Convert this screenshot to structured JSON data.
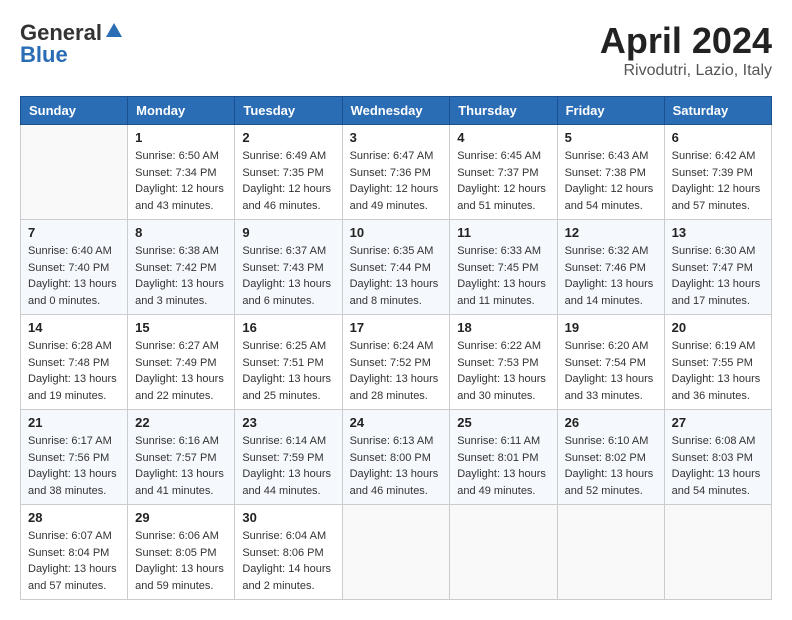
{
  "header": {
    "logo_general": "General",
    "logo_blue": "Blue",
    "title": "April 2024",
    "location": "Rivodutri, Lazio, Italy"
  },
  "calendar": {
    "columns": [
      "Sunday",
      "Monday",
      "Tuesday",
      "Wednesday",
      "Thursday",
      "Friday",
      "Saturday"
    ],
    "weeks": [
      [
        {
          "day": "",
          "info": ""
        },
        {
          "day": "1",
          "info": "Sunrise: 6:50 AM\nSunset: 7:34 PM\nDaylight: 12 hours\nand 43 minutes."
        },
        {
          "day": "2",
          "info": "Sunrise: 6:49 AM\nSunset: 7:35 PM\nDaylight: 12 hours\nand 46 minutes."
        },
        {
          "day": "3",
          "info": "Sunrise: 6:47 AM\nSunset: 7:36 PM\nDaylight: 12 hours\nand 49 minutes."
        },
        {
          "day": "4",
          "info": "Sunrise: 6:45 AM\nSunset: 7:37 PM\nDaylight: 12 hours\nand 51 minutes."
        },
        {
          "day": "5",
          "info": "Sunrise: 6:43 AM\nSunset: 7:38 PM\nDaylight: 12 hours\nand 54 minutes."
        },
        {
          "day": "6",
          "info": "Sunrise: 6:42 AM\nSunset: 7:39 PM\nDaylight: 12 hours\nand 57 minutes."
        }
      ],
      [
        {
          "day": "7",
          "info": "Sunrise: 6:40 AM\nSunset: 7:40 PM\nDaylight: 13 hours\nand 0 minutes."
        },
        {
          "day": "8",
          "info": "Sunrise: 6:38 AM\nSunset: 7:42 PM\nDaylight: 13 hours\nand 3 minutes."
        },
        {
          "day": "9",
          "info": "Sunrise: 6:37 AM\nSunset: 7:43 PM\nDaylight: 13 hours\nand 6 minutes."
        },
        {
          "day": "10",
          "info": "Sunrise: 6:35 AM\nSunset: 7:44 PM\nDaylight: 13 hours\nand 8 minutes."
        },
        {
          "day": "11",
          "info": "Sunrise: 6:33 AM\nSunset: 7:45 PM\nDaylight: 13 hours\nand 11 minutes."
        },
        {
          "day": "12",
          "info": "Sunrise: 6:32 AM\nSunset: 7:46 PM\nDaylight: 13 hours\nand 14 minutes."
        },
        {
          "day": "13",
          "info": "Sunrise: 6:30 AM\nSunset: 7:47 PM\nDaylight: 13 hours\nand 17 minutes."
        }
      ],
      [
        {
          "day": "14",
          "info": "Sunrise: 6:28 AM\nSunset: 7:48 PM\nDaylight: 13 hours\nand 19 minutes."
        },
        {
          "day": "15",
          "info": "Sunrise: 6:27 AM\nSunset: 7:49 PM\nDaylight: 13 hours\nand 22 minutes."
        },
        {
          "day": "16",
          "info": "Sunrise: 6:25 AM\nSunset: 7:51 PM\nDaylight: 13 hours\nand 25 minutes."
        },
        {
          "day": "17",
          "info": "Sunrise: 6:24 AM\nSunset: 7:52 PM\nDaylight: 13 hours\nand 28 minutes."
        },
        {
          "day": "18",
          "info": "Sunrise: 6:22 AM\nSunset: 7:53 PM\nDaylight: 13 hours\nand 30 minutes."
        },
        {
          "day": "19",
          "info": "Sunrise: 6:20 AM\nSunset: 7:54 PM\nDaylight: 13 hours\nand 33 minutes."
        },
        {
          "day": "20",
          "info": "Sunrise: 6:19 AM\nSunset: 7:55 PM\nDaylight: 13 hours\nand 36 minutes."
        }
      ],
      [
        {
          "day": "21",
          "info": "Sunrise: 6:17 AM\nSunset: 7:56 PM\nDaylight: 13 hours\nand 38 minutes."
        },
        {
          "day": "22",
          "info": "Sunrise: 6:16 AM\nSunset: 7:57 PM\nDaylight: 13 hours\nand 41 minutes."
        },
        {
          "day": "23",
          "info": "Sunrise: 6:14 AM\nSunset: 7:59 PM\nDaylight: 13 hours\nand 44 minutes."
        },
        {
          "day": "24",
          "info": "Sunrise: 6:13 AM\nSunset: 8:00 PM\nDaylight: 13 hours\nand 46 minutes."
        },
        {
          "day": "25",
          "info": "Sunrise: 6:11 AM\nSunset: 8:01 PM\nDaylight: 13 hours\nand 49 minutes."
        },
        {
          "day": "26",
          "info": "Sunrise: 6:10 AM\nSunset: 8:02 PM\nDaylight: 13 hours\nand 52 minutes."
        },
        {
          "day": "27",
          "info": "Sunrise: 6:08 AM\nSunset: 8:03 PM\nDaylight: 13 hours\nand 54 minutes."
        }
      ],
      [
        {
          "day": "28",
          "info": "Sunrise: 6:07 AM\nSunset: 8:04 PM\nDaylight: 13 hours\nand 57 minutes."
        },
        {
          "day": "29",
          "info": "Sunrise: 6:06 AM\nSunset: 8:05 PM\nDaylight: 13 hours\nand 59 minutes."
        },
        {
          "day": "30",
          "info": "Sunrise: 6:04 AM\nSunset: 8:06 PM\nDaylight: 14 hours\nand 2 minutes."
        },
        {
          "day": "",
          "info": ""
        },
        {
          "day": "",
          "info": ""
        },
        {
          "day": "",
          "info": ""
        },
        {
          "day": "",
          "info": ""
        }
      ]
    ]
  }
}
